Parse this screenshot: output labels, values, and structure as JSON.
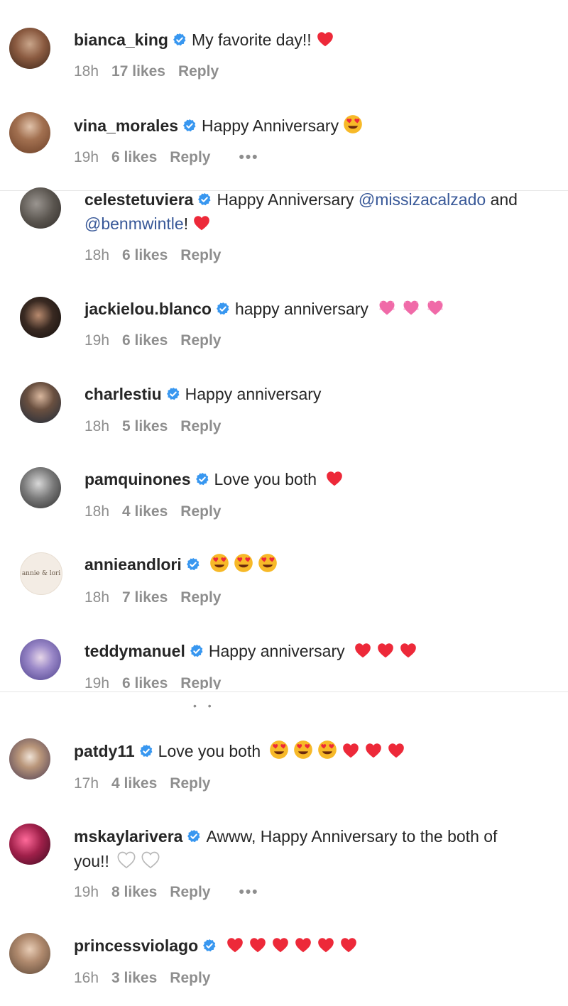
{
  "comments": [
    {
      "user": "bianca_king",
      "text": "My favorite day!!",
      "time": "18h",
      "likes": "17 likes",
      "reply": "Reply",
      "emojis": [
        "red-heart"
      ]
    },
    {
      "user": "vina_morales",
      "text": "Happy Anniversary",
      "time": "19h",
      "likes": "6 likes",
      "reply": "Reply",
      "more": "•••",
      "emojis": [
        "heart-eyes"
      ]
    },
    {
      "user": "celestetuviera",
      "text": "Happy Anniversary",
      "mention1": "@missizacalzado",
      "and": "and",
      "mention2": "@benmwintle",
      "tail": "!",
      "time": "18h",
      "likes": "6 likes",
      "reply": "Reply",
      "emojis": [
        "red-heart"
      ]
    },
    {
      "user": "jackielou.blanco",
      "text": "happy anniversary",
      "time": "19h",
      "likes": "6 likes",
      "reply": "Reply",
      "emojis": [
        "pink-heart",
        "pink-heart",
        "pink-heart"
      ]
    },
    {
      "user": "charlestiu",
      "text": "Happy anniversary",
      "time": "18h",
      "likes": "5 likes",
      "reply": "Reply",
      "emojis": []
    },
    {
      "user": "pamquinones",
      "text": "Love you both",
      "time": "18h",
      "likes": "4 likes",
      "reply": "Reply",
      "emojis": [
        "red-heart"
      ]
    },
    {
      "user": "annieandlori",
      "text": "",
      "time": "18h",
      "likes": "7 likes",
      "reply": "Reply",
      "avatar_text": "annie & lori",
      "emojis": [
        "heart-eyes",
        "heart-eyes",
        "heart-eyes"
      ]
    },
    {
      "user": "teddymanuel",
      "text": "Happy anniversary",
      "time": "19h",
      "likes": "6 likes",
      "reply": "Reply",
      "emojis": [
        "red-heart",
        "red-heart",
        "red-heart"
      ]
    },
    {
      "user": "patdy11",
      "text": "Love you both",
      "time": "17h",
      "likes": "4 likes",
      "reply": "Reply",
      "emojis": [
        "heart-eyes",
        "heart-eyes",
        "heart-eyes",
        "red-heart",
        "red-heart",
        "red-heart"
      ]
    },
    {
      "user": "mskaylarivera",
      "text": "Awww, Happy Anniversary to the both of",
      "text2": "you!!",
      "time": "19h",
      "likes": "8 likes",
      "reply": "Reply",
      "more": "•••",
      "emojis": [
        "white-heart",
        "white-heart"
      ]
    },
    {
      "user": "princessviolago",
      "text": "",
      "time": "16h",
      "likes": "3 likes",
      "reply": "Reply",
      "emojis": [
        "red-heart",
        "red-heart",
        "red-heart",
        "red-heart",
        "red-heart",
        "red-heart"
      ]
    }
  ],
  "colors": {
    "verified": "#3897f0",
    "mention": "#385898",
    "red_heart": "#ed2939",
    "pink_heart": "#f06aa8",
    "emoji_face": "#f7b928"
  }
}
